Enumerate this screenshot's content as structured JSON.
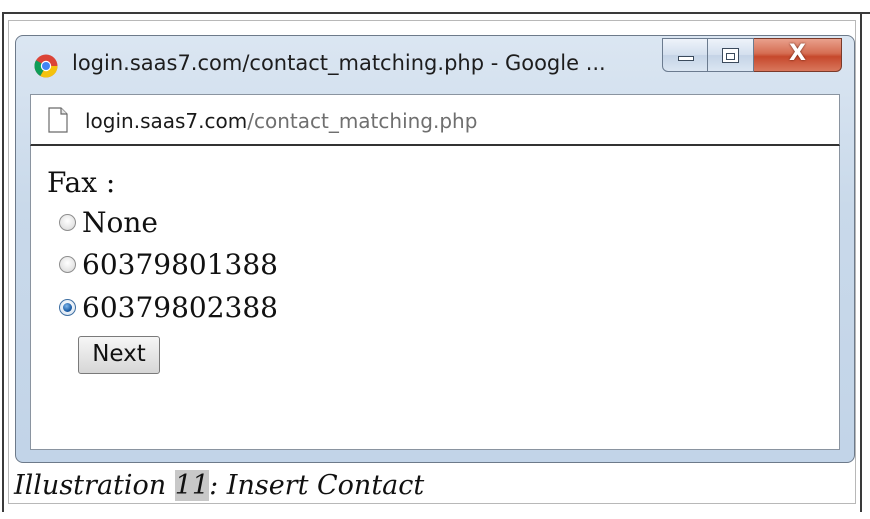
{
  "window": {
    "title": "login.saas7.com/contact_matching.php - Google ...",
    "controls": {
      "minimize": "minimize",
      "maximize": "maximize",
      "close": "X"
    }
  },
  "addressbar": {
    "host": "login.saas7.com",
    "path": "/contact_matching.php"
  },
  "form": {
    "label": "Fax :",
    "options": [
      {
        "label": "None",
        "checked": false
      },
      {
        "label": "60379801388",
        "checked": false
      },
      {
        "label": "60379802388",
        "checked": true
      }
    ],
    "next_label": "Next"
  },
  "caption": {
    "prefix": "Illustration ",
    "number": "11",
    "suffix": ": Insert Contact"
  },
  "colors": {
    "window_frame": "#c9d9ea",
    "close_button": "#c6482c",
    "radio_checked": "#1d5fa8"
  },
  "icons": [
    "chrome-icon",
    "page-icon",
    "minimize-icon",
    "maximize-icon",
    "close-icon"
  ]
}
